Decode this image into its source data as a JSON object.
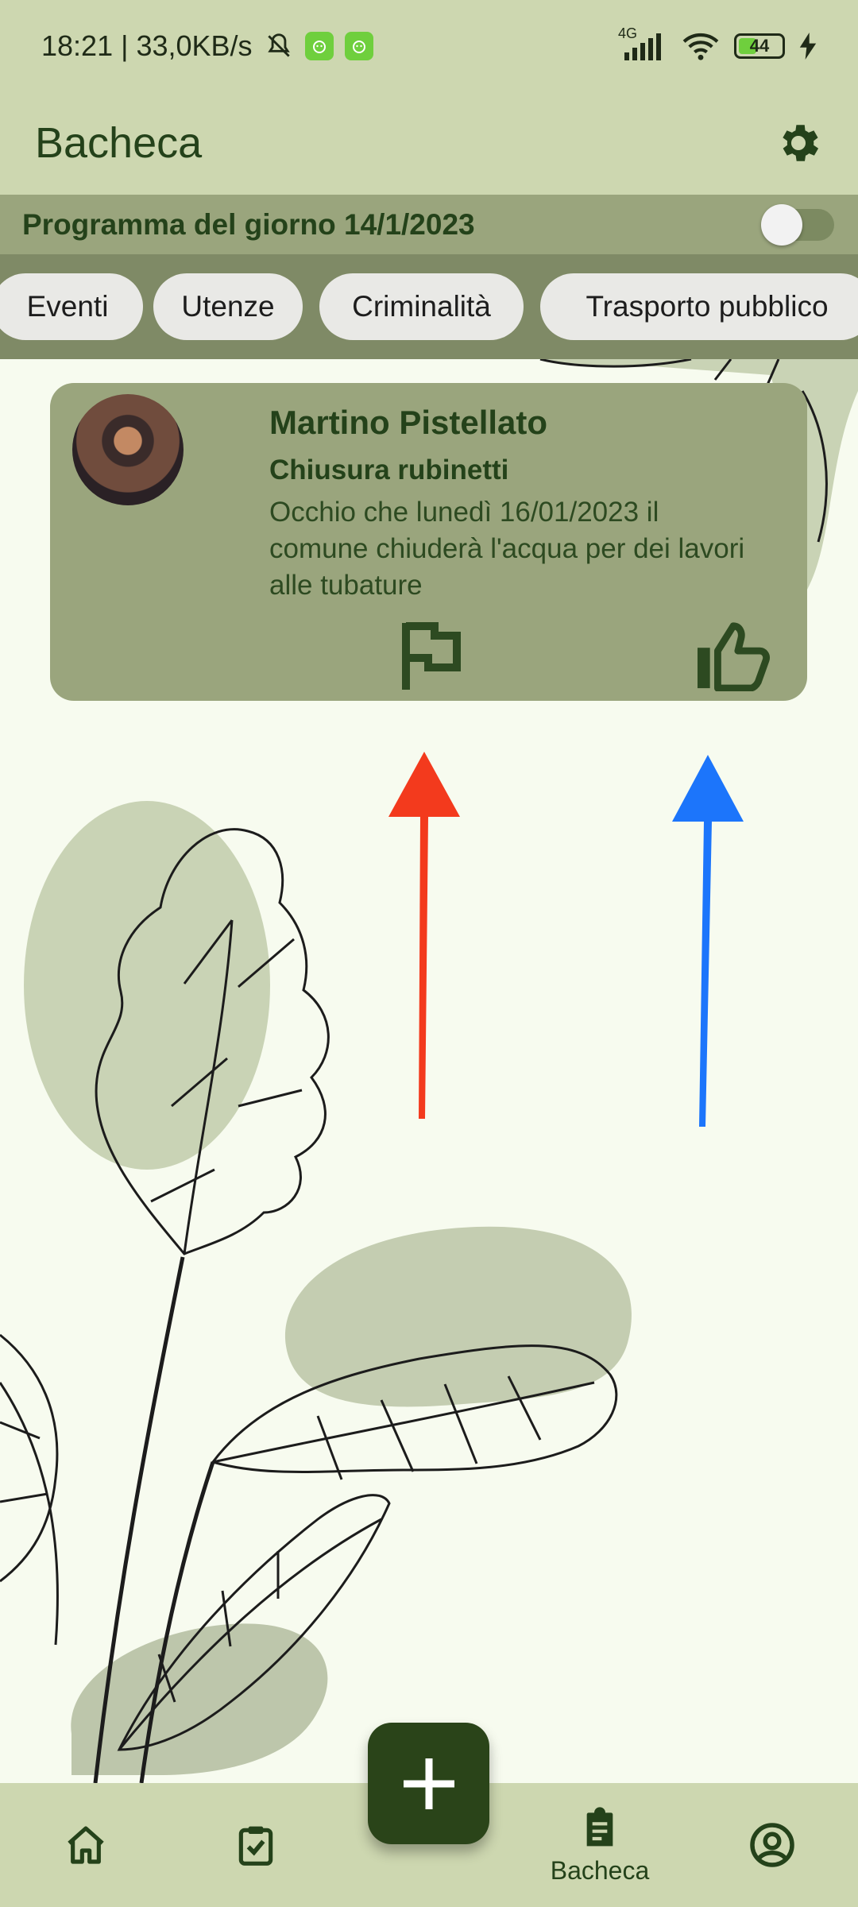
{
  "status_bar": {
    "time_speed": "18:21 | 33,0KB/s",
    "network": "4G",
    "battery": "44"
  },
  "app_bar": {
    "title": "Bacheca",
    "settings_icon": "gear-icon"
  },
  "program": {
    "label": "Programma del giorno 14/1/2023",
    "toggle_on": false
  },
  "chips": [
    "Eventi",
    "Utenze",
    "Criminalità",
    "Trasporto pubblico"
  ],
  "post": {
    "author": "Martino Pistellato",
    "subject": "Chiusura rubinetti",
    "body": "Occhio che lunedì 16/01/2023 il comune chiuderà l'acqua per dei lavori alle tubature",
    "report_icon": "flag-icon",
    "like_icon": "thumb-up-icon"
  },
  "annotations": {
    "report_arrow_color": "#f33a1d",
    "like_arrow_color": "#1c75fb"
  },
  "bottom_nav": {
    "items": [
      {
        "icon": "home-icon"
      },
      {
        "icon": "checklist-icon"
      },
      {
        "icon": "clipboard-icon",
        "label": "Bacheca"
      },
      {
        "icon": "account-circle-icon"
      }
    ],
    "fab_icon": "plus-icon"
  },
  "colors": {
    "bar": "#cdd7b0",
    "card": "#9aa57d",
    "dark_green": "#24421a"
  }
}
